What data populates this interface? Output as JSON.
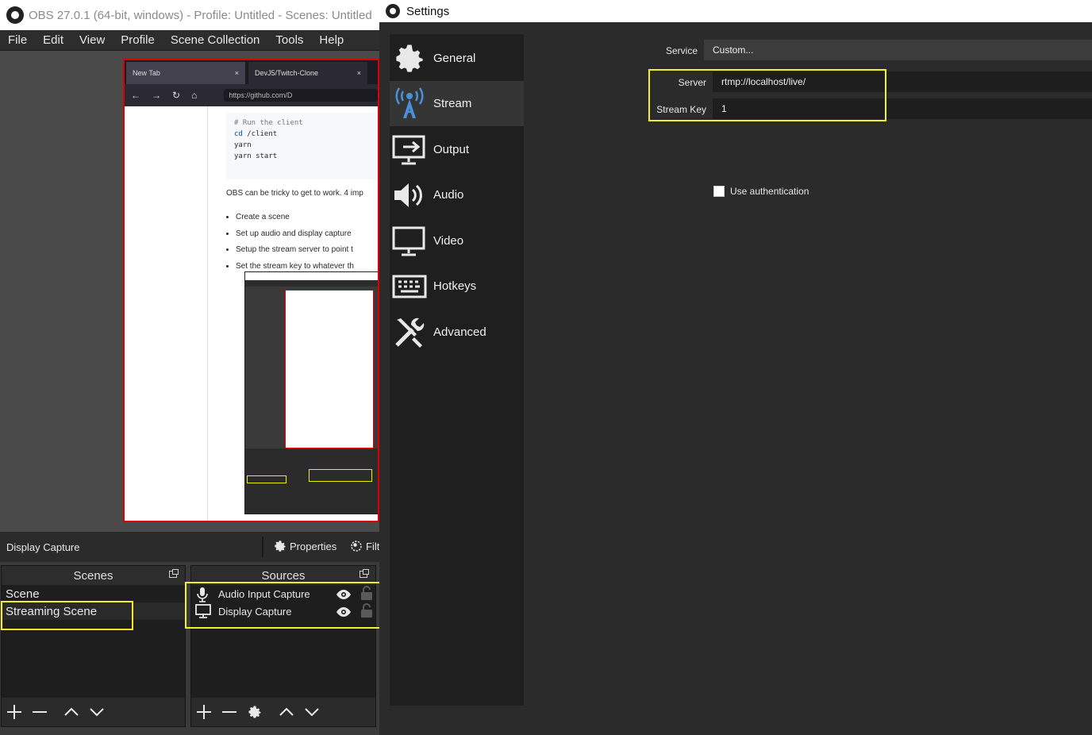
{
  "obs": {
    "window_title": "OBS 27.0.1 (64-bit, windows) - Profile: Untitled - Scenes: Untitled",
    "menu": [
      "File",
      "Edit",
      "View",
      "Profile",
      "Scene Collection",
      "Tools",
      "Help"
    ],
    "preview": {
      "browser_tabs": [
        "New Tab",
        "DevJ5/Twitch-Clone"
      ],
      "url": "https://github.com/D",
      "code_lines": [
        "# Run the client",
        "cd /client",
        "yarn",
        "yarn start"
      ],
      "paragraph": "OBS can be tricky to get to work. 4 imp",
      "bullets": [
        "Create a scene",
        "Set up audio and display capture",
        "Setup the stream server to point t",
        "Set the stream key to whatever th"
      ]
    },
    "source_toolbar": {
      "selected_source": "Display Capture",
      "properties_label": "Properties",
      "filters_label": "Filt"
    },
    "scenes": {
      "title": "Scenes",
      "items": [
        "Scene",
        "Streaming Scene"
      ]
    },
    "sources": {
      "title": "Sources",
      "items": [
        "Audio Input Capture",
        "Display Capture"
      ]
    }
  },
  "settings": {
    "window_title": "Settings",
    "nav": [
      {
        "label": "General",
        "icon": "gear-icon"
      },
      {
        "label": "Stream",
        "icon": "broadcast-antenna-icon"
      },
      {
        "label": "Output",
        "icon": "output-monitor-icon"
      },
      {
        "label": "Audio",
        "icon": "speaker-icon"
      },
      {
        "label": "Video",
        "icon": "monitor-icon"
      },
      {
        "label": "Hotkeys",
        "icon": "keyboard-icon"
      },
      {
        "label": "Advanced",
        "icon": "tools-icon"
      }
    ],
    "active_nav": "Stream",
    "form": {
      "service_label": "Service",
      "service_value": "Custom...",
      "server_label": "Server",
      "server_value": "rtmp://localhost/live/",
      "stream_key_label": "Stream Key",
      "stream_key_value": "1",
      "use_auth_label": "Use authentication",
      "use_auth_checked": false
    }
  },
  "colors": {
    "highlight": "#f4f02b",
    "active_nav_bg": "#353535",
    "panel_bg": "#1f1f1f"
  }
}
